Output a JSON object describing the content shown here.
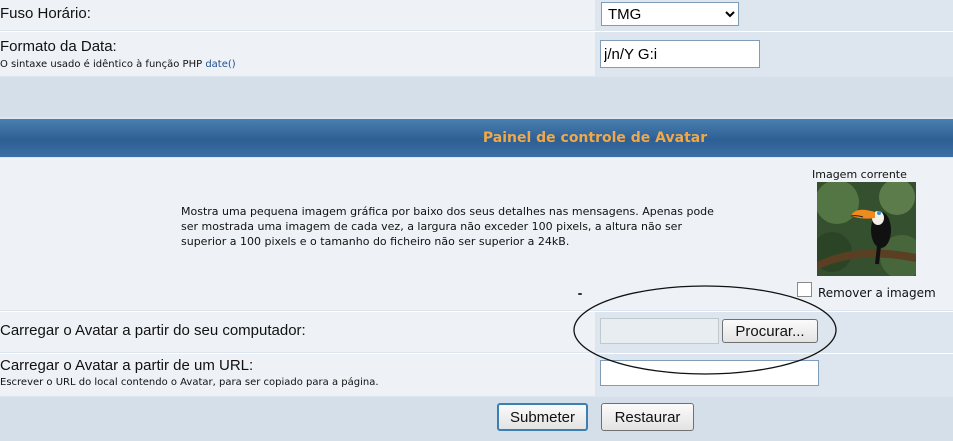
{
  "timezone": {
    "label": "Fuso Horário:",
    "selected": "TMG"
  },
  "date_format": {
    "label": "Formato da Data:",
    "help_prefix": "O sintaxe usado é idêntico à função PHP",
    "help_link": "date()",
    "value": "j/n/Y G:i"
  },
  "avatar_panel": {
    "title": "Painel de controle de Avatar",
    "description": "Mostra uma pequena imagem gráfica por baixo dos seus detalhes nas mensagens. Apenas pode ser mostrada uma imagem de cada vez, a largura não exceder 100 pixels, a altura não ser superior a 100 pixels e o tamanho do ficheiro não ser superior a 24kB.",
    "current_image_label": "Imagem corrente",
    "remove_label": "Remover a imagem"
  },
  "upload_from_computer": {
    "label": "Carregar o Avatar a partir do seu computador:",
    "file_value": "",
    "browse_button": "Procurar..."
  },
  "upload_from_url": {
    "label": "Carregar o Avatar a partir de um URL:",
    "help": "Escrever o URL do local contendo o Avatar, para ser copiado para a página.",
    "value": ""
  },
  "actions": {
    "submit": "Submeter",
    "reset": "Restaurar"
  },
  "colors": {
    "header_bar": "#3a6b9e",
    "header_text": "#f0a848",
    "label_cell": "#eef2f7",
    "value_cell": "#dde6ef"
  }
}
